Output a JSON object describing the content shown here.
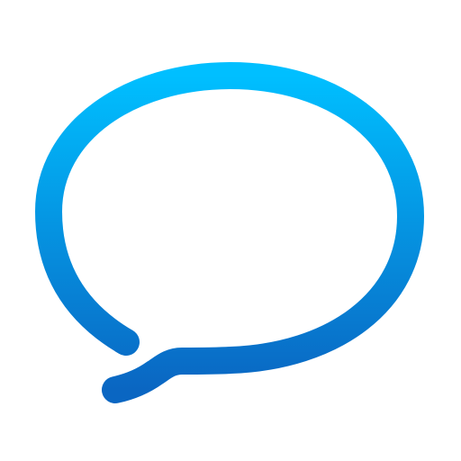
{
  "icon": {
    "name": "chat-bubble-icon",
    "gradient_top": "#00BFFF",
    "gradient_bottom": "#0A66C2",
    "background": "#FFFFFF"
  }
}
